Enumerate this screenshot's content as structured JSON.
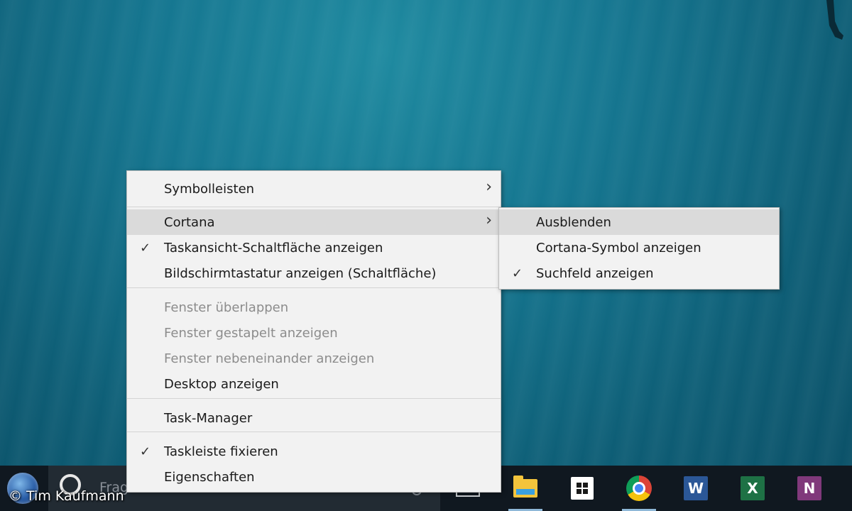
{
  "taskbar": {
    "search_placeholder": "Frag mich etwas",
    "apps": [
      {
        "name": "file-explorer"
      },
      {
        "name": "store"
      },
      {
        "name": "chrome"
      },
      {
        "name": "word",
        "glyph": "W"
      },
      {
        "name": "excel",
        "glyph": "X"
      },
      {
        "name": "onenote",
        "glyph": "N"
      }
    ]
  },
  "context_menu": {
    "items": [
      {
        "label": "Symbolleisten",
        "submenu": true
      },
      {
        "label": "Cortana",
        "submenu": true,
        "highlighted": true
      },
      {
        "label": "Taskansicht-Schaltfläche anzeigen",
        "checked": true
      },
      {
        "label": "Bildschirmtastatur anzeigen (Schaltfläche)"
      },
      {
        "label": "Fenster überlappen",
        "disabled": true
      },
      {
        "label": "Fenster gestapelt anzeigen",
        "disabled": true
      },
      {
        "label": "Fenster nebeneinander anzeigen",
        "disabled": true
      },
      {
        "label": "Desktop anzeigen"
      },
      {
        "label": "Task-Manager"
      },
      {
        "label": "Taskleiste fixieren",
        "checked": true
      },
      {
        "label": "Eigenschaften"
      }
    ]
  },
  "cortana_submenu": {
    "items": [
      {
        "label": "Ausblenden",
        "highlighted": true
      },
      {
        "label": "Cortana-Symbol anzeigen"
      },
      {
        "label": "Suchfeld anzeigen",
        "checked": true
      }
    ]
  },
  "icons": {
    "check": "✓",
    "chevron": "›"
  },
  "watermark": "© Tim Kaufmann"
}
